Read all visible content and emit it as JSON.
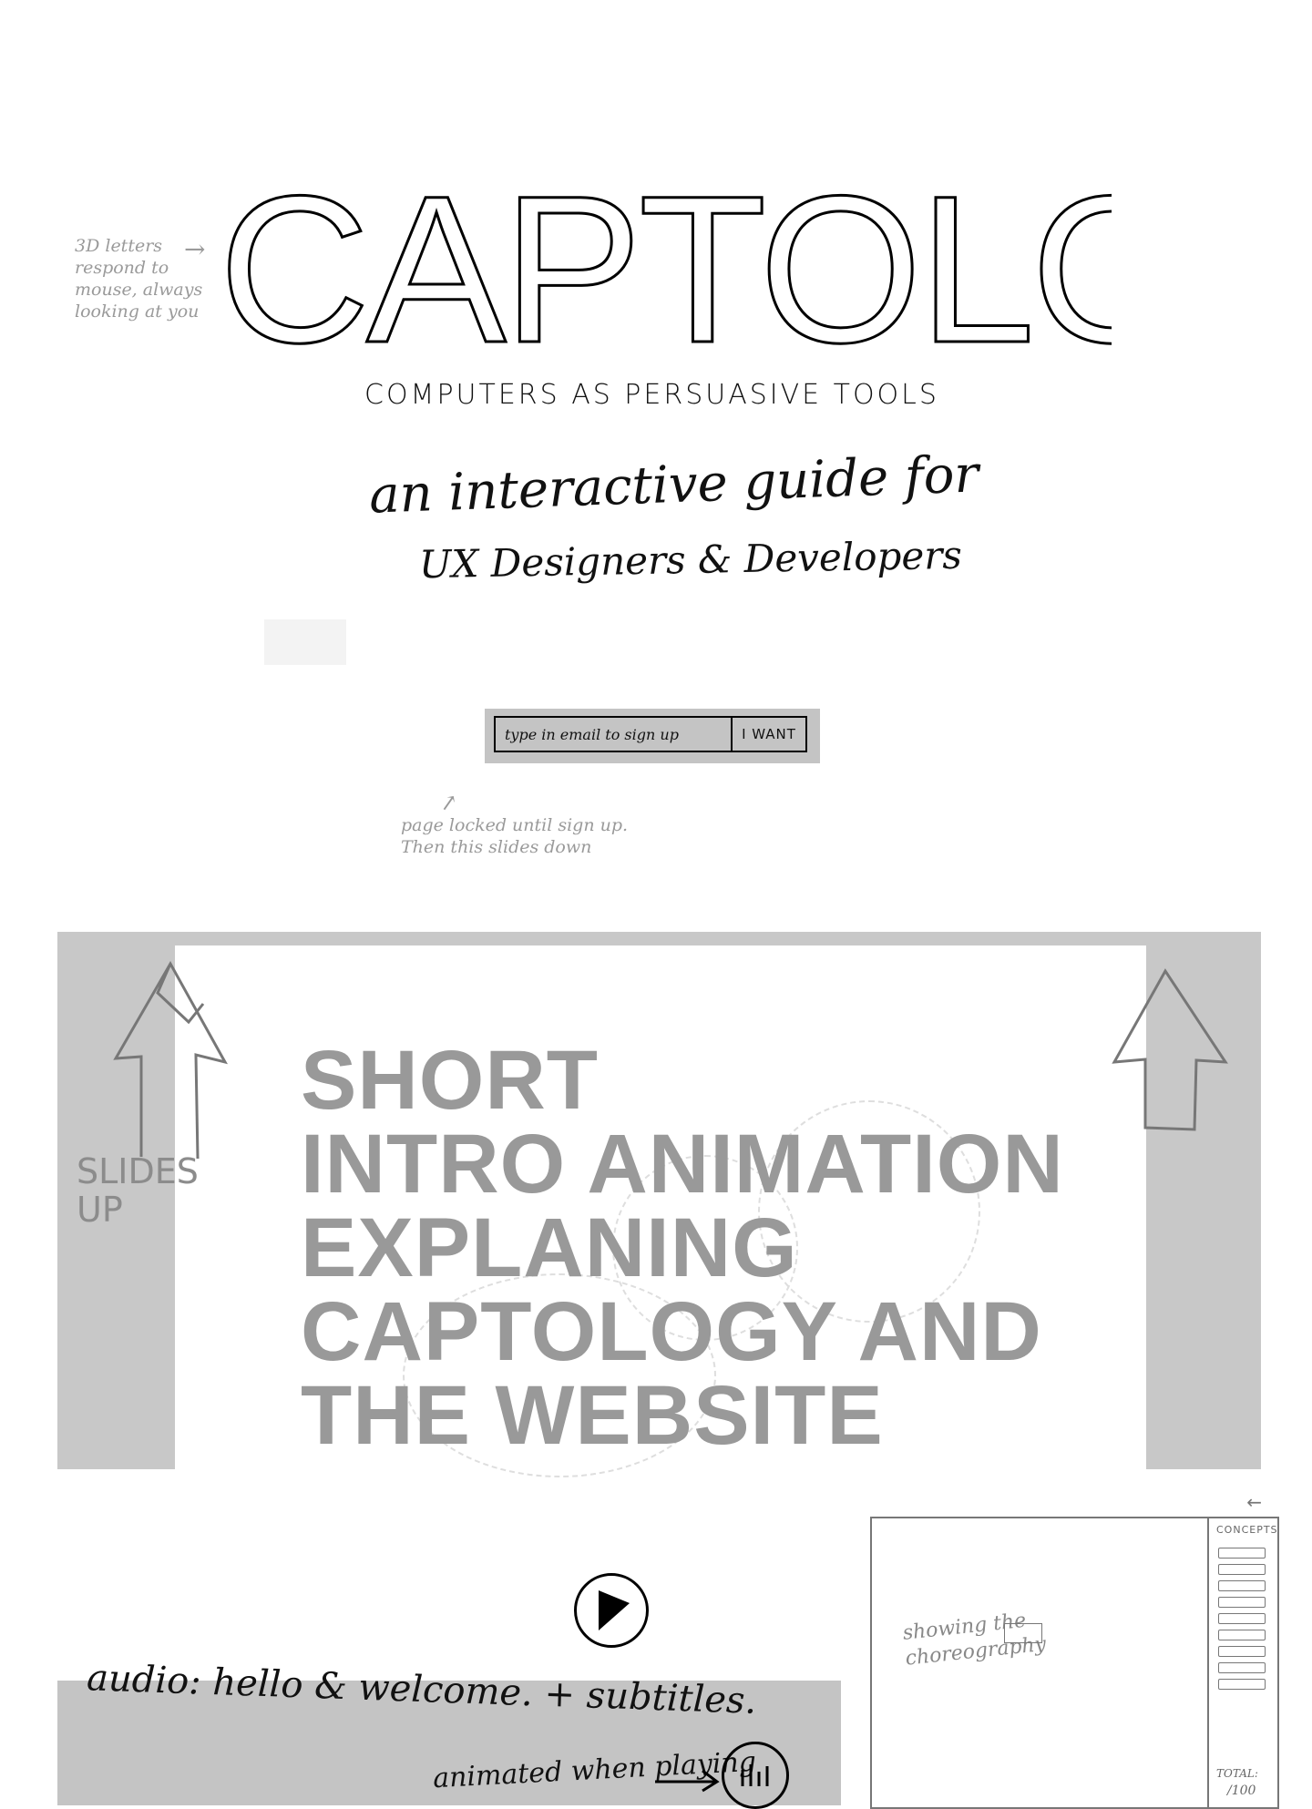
{
  "hero": {
    "title": "CAPTOLOGY",
    "subtitle": "COMPUTERS AS PERSUASIVE TOOLS",
    "tagline_line1": "an interactive guide for",
    "tagline_line2": "UX Designers & Developers"
  },
  "notes": {
    "letters": "3D letters respond to mouse, always looking at you",
    "locked": "page locked until sign up. Then this slides down"
  },
  "signup": {
    "placeholder": "type in email to sign up",
    "button_label": "I WANT"
  },
  "intro": {
    "heading_lines": [
      "SHORT",
      "INTRO ANIMATION",
      "EXPLANING",
      "CAPTOLOGY AND",
      "THE WEBSITE"
    ],
    "slides_label": "SLIDES UP"
  },
  "audio": {
    "note": "audio: hello & welcome. + subtitles.",
    "animated_note": "animated when playing"
  },
  "choreography": {
    "sidebar_title": "CONCEPTS",
    "note": "showing the choreography",
    "total_label": "TOTAL:",
    "total_value": "/100"
  },
  "colors": {
    "panel_gray": "#c8c8c8",
    "heading_gray": "#999999",
    "note_gray": "#9a9a9a"
  }
}
